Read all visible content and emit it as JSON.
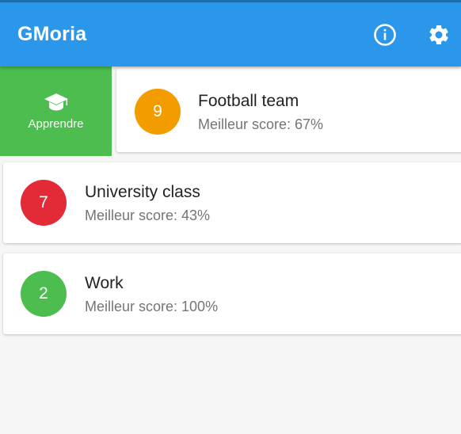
{
  "header": {
    "title": "GMoria",
    "info_icon": "info-circle-icon",
    "settings_icon": "gear-icon"
  },
  "swipe_action": {
    "icon": "graduation-cap-icon",
    "label": "Apprendre",
    "color": "#4cbd4e"
  },
  "groups": [
    {
      "count": "9",
      "name": "Football team",
      "score": "Meilleur score: 67%",
      "color": "#f39c00"
    },
    {
      "count": "7",
      "name": "University class",
      "score": "Meilleur score: 43%",
      "color": "#e32b38"
    },
    {
      "count": "2",
      "name": "Work",
      "score": "Meilleur score: 100%",
      "color": "#4cbd4e"
    }
  ],
  "colors": {
    "app_bar": "#2a97ea",
    "background": "#f6f6f6"
  }
}
